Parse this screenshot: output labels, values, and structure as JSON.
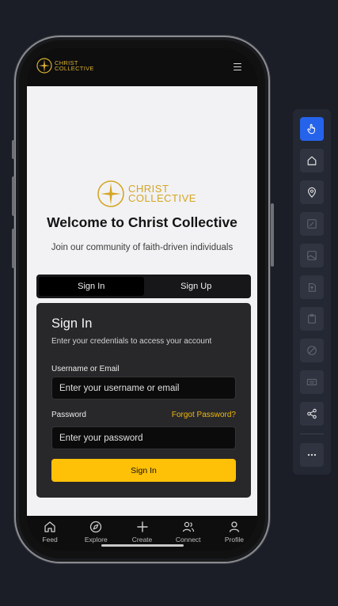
{
  "header": {
    "logo_line1": "CHRIST",
    "logo_line2": "COLLECTIVE"
  },
  "brand": {
    "line1": "CHRIST",
    "line2": "COLLECTIVE"
  },
  "welcome_title": "Welcome to Christ Collective",
  "tagline": "Join our community of faith-driven individuals",
  "tabs": [
    {
      "label": "Sign In",
      "active": true
    },
    {
      "label": "Sign Up",
      "active": false
    }
  ],
  "signin": {
    "title": "Sign In",
    "subtitle": "Enter your credentials to access your account",
    "username_label": "Username or Email",
    "username_placeholder": "Enter your username or email",
    "password_label": "Password",
    "forgot_link": "Forgot Password?",
    "password_placeholder": "Enter your password",
    "submit_label": "Sign In"
  },
  "nav": [
    {
      "label": "Feed",
      "icon": "home-icon"
    },
    {
      "label": "Explore",
      "icon": "compass-icon"
    },
    {
      "label": "Create",
      "icon": "plus-icon"
    },
    {
      "label": "Connect",
      "icon": "users-icon"
    },
    {
      "label": "Profile",
      "icon": "user-icon"
    }
  ],
  "toolbar": [
    "pointer-icon",
    "home-icon",
    "location-pin-icon",
    "edit-icon",
    "image-icon",
    "export-icon",
    "clipboard-icon",
    "erase-icon",
    "keyboard-icon",
    "share-icon",
    "more-icon"
  ],
  "colors": {
    "accent": "#ffc107",
    "brand_gold": "#d4a624",
    "toolbar_active": "#2563eb"
  }
}
